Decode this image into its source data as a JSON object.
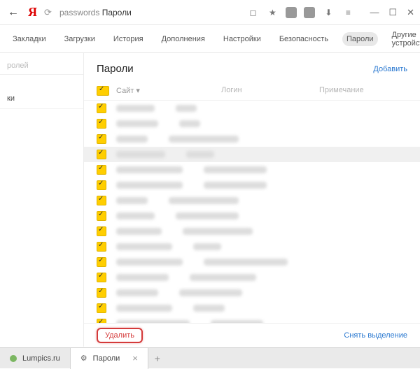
{
  "titlebar": {
    "address_path": "passwords",
    "address_label": "Пароли"
  },
  "settings_nav": {
    "tabs": [
      {
        "label": "Закладки"
      },
      {
        "label": "Загрузки"
      },
      {
        "label": "История"
      },
      {
        "label": "Дополнения"
      },
      {
        "label": "Настройки"
      },
      {
        "label": "Безопасность"
      },
      {
        "label": "Пароли",
        "active": true
      },
      {
        "label": "Другие устройства"
      }
    ]
  },
  "sidebar": {
    "search_placeholder": "ролей",
    "items": [
      {
        "label": "ки"
      }
    ]
  },
  "main": {
    "heading": "Пароли",
    "add_label": "Добавить",
    "columns": {
      "site": "Сайт ▾",
      "login": "Логин",
      "note": "Примечание"
    },
    "rows": [
      {
        "w1": 55,
        "w2": 30
      },
      {
        "w1": 60,
        "w2": 30
      },
      {
        "w1": 45,
        "w2": 100
      },
      {
        "w1": 70,
        "w2": 40,
        "hl": true
      },
      {
        "w1": 95,
        "w2": 90
      },
      {
        "w1": 95,
        "w2": 90
      },
      {
        "w1": 45,
        "w2": 100
      },
      {
        "w1": 55,
        "w2": 90
      },
      {
        "w1": 65,
        "w2": 100
      },
      {
        "w1": 80,
        "w2": 40
      },
      {
        "w1": 95,
        "w2": 120
      },
      {
        "w1": 75,
        "w2": 95
      },
      {
        "w1": 60,
        "w2": 90
      },
      {
        "w1": 80,
        "w2": 45
      },
      {
        "w1": 105,
        "w2": 75
      }
    ],
    "delete_label": "Удалить",
    "deselect_label": "Снять выделение"
  },
  "browser_tabs": {
    "tab1": "Lumpics.ru",
    "tab2": "Пароли"
  }
}
